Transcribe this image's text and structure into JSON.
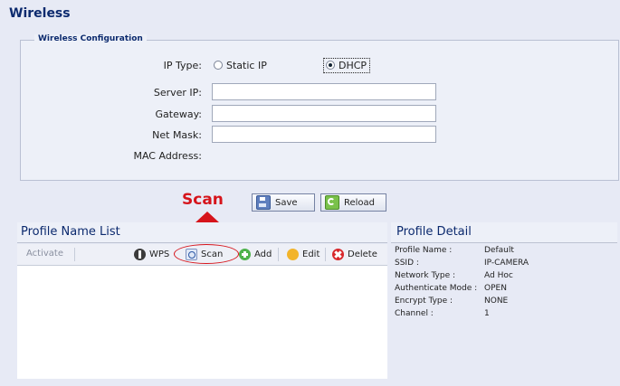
{
  "page_title": "Wireless",
  "config": {
    "legend": "Wireless Configuration",
    "ip_type_label": "IP Type:",
    "static_ip_label": "Static IP",
    "dhcp_label": "DHCP",
    "server_ip_label": "Server IP:",
    "gateway_label": "Gateway:",
    "net_mask_label": "Net Mask:",
    "mac_address_label": "MAC Address:",
    "server_ip_value": "",
    "gateway_value": "",
    "net_mask_value": "",
    "mac_address_value": ""
  },
  "callout": {
    "text": "Scan",
    "color": "#d6141b"
  },
  "actions": {
    "save_label": "Save",
    "reload_label": "Reload"
  },
  "profile_list": {
    "title": "Profile Name List",
    "activate_label": "Activate",
    "wps_label": "WPS",
    "scan_label": "Scan",
    "add_label": "Add",
    "edit_label": "Edit",
    "delete_label": "Delete"
  },
  "profile_detail": {
    "title": "Profile Detail",
    "rows": [
      {
        "label": "Profile Name :",
        "value": "Default"
      },
      {
        "label": "SSID :",
        "value": "IP-CAMERA"
      },
      {
        "label": "Network Type :",
        "value": "Ad Hoc"
      },
      {
        "label": "Authenticate Mode :",
        "value": "OPEN"
      },
      {
        "label": "Encrypt Type :",
        "value": "NONE"
      },
      {
        "label": "Channel :",
        "value": "1"
      }
    ]
  },
  "colors": {
    "heading": "#0c2a6e",
    "background": "#e7eaf5",
    "panel": "#edf0f8",
    "callout_red": "#d6141b"
  }
}
